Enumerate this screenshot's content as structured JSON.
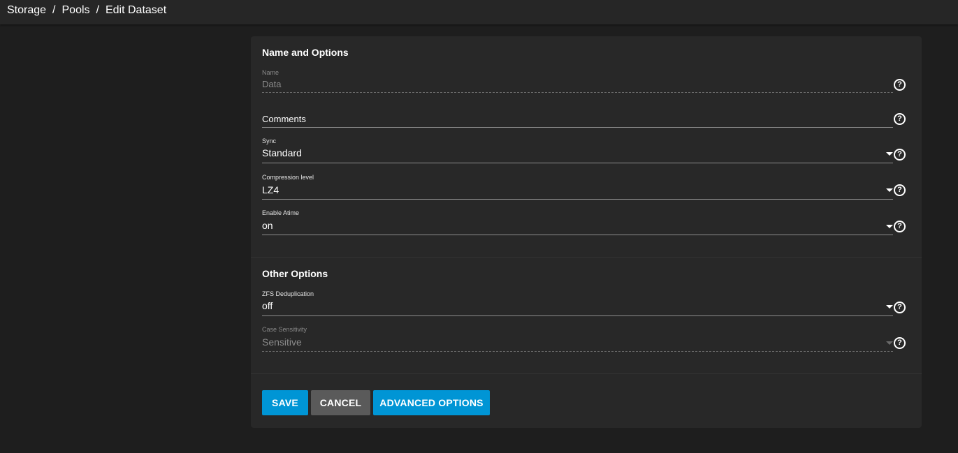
{
  "breadcrumb": [
    "Storage",
    "Pools",
    "Edit Dataset"
  ],
  "breadcrumb_separator": "/",
  "sections": {
    "name_options": "Name and Options",
    "other_options": "Other Options"
  },
  "fields": {
    "name": {
      "label": "Name",
      "value": "Data"
    },
    "comments": {
      "value": "Comments"
    },
    "sync": {
      "label": "Sync",
      "value": "Standard"
    },
    "compression": {
      "label": "Compression level",
      "value": "LZ4"
    },
    "atime": {
      "label": "Enable Atime",
      "value": "on"
    },
    "dedup": {
      "label": "ZFS Deduplication",
      "value": "off"
    },
    "case": {
      "label": "Case Sensitivity",
      "value": "Sensitive"
    }
  },
  "help_glyph": "?",
  "buttons": {
    "save": "SAVE",
    "cancel": "CANCEL",
    "advanced": "ADVANCED OPTIONS"
  },
  "colors": {
    "primary": "#0095d5",
    "secondary": "#5a5a5a",
    "background": "#1e1e1e",
    "card": "#282828"
  },
  "icons": {
    "help": "help-circle-icon",
    "dropdown": "chevron-down-icon"
  }
}
